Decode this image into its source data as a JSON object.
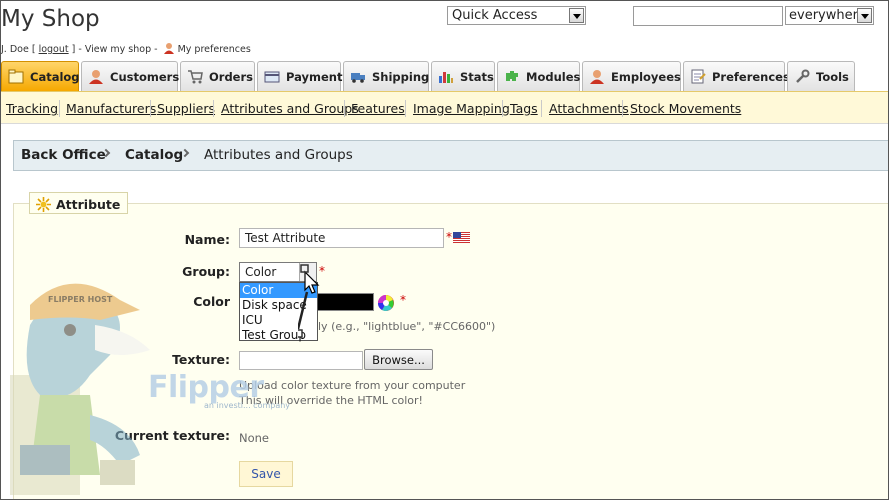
{
  "header": {
    "shop_title": "My Shop",
    "user_name": "J. Doe [",
    "logout": "logout",
    "user_tail": "] - View my shop -",
    "my_preferences": "My preferences",
    "quick_access": "Quick Access",
    "search_value": "",
    "search_scope": "everywhere"
  },
  "tabs": [
    {
      "label": "Catalog",
      "icon": "catalog-icon",
      "active": true
    },
    {
      "label": "Customers",
      "icon": "customers-icon"
    },
    {
      "label": "Orders",
      "icon": "orders-icon"
    },
    {
      "label": "Payment",
      "icon": "payment-icon"
    },
    {
      "label": "Shipping",
      "icon": "shipping-icon"
    },
    {
      "label": "Stats",
      "icon": "stats-icon"
    },
    {
      "label": "Modules",
      "icon": "modules-icon"
    },
    {
      "label": "Employees",
      "icon": "employees-icon"
    },
    {
      "label": "Preferences",
      "icon": "preferences-icon"
    },
    {
      "label": "Tools",
      "icon": "tools-icon"
    }
  ],
  "subnav": [
    "Tracking",
    "Manufacturers",
    "Suppliers",
    "Attributes and Groups",
    "Features",
    "Image Mapping",
    "Tags",
    "Attachments",
    "Stock Movements"
  ],
  "breadcrumb": [
    "Back Office",
    "Catalog",
    "Attributes and Groups"
  ],
  "form": {
    "legend": "Attribute",
    "name_label": "Name:",
    "name_value": "Test Attribute",
    "group_label": "Group:",
    "group_value": "Color",
    "group_options": [
      "Color",
      "Disk space",
      "ICU",
      "Test Group"
    ],
    "color_label": "Color",
    "color_hint": "ly (e.g., \"lightblue\", \"#CC6600\")",
    "texture_label": "Texture:",
    "browse_label": "Browse...",
    "texture_hint_1": "Upload color texture from your computer",
    "texture_hint_2": "This will override the HTML color!",
    "current_texture_label": "Current texture:",
    "current_texture_value": "None",
    "save_label": "Save",
    "required_mark": "*"
  },
  "watermark": {
    "brand": "Flipper",
    "tagline": "an investi... company",
    "cap_text": "FLIPPER HOST"
  },
  "colors": {
    "active_tab": "#f5a800",
    "subnav_bg": "#fff9d8",
    "breadcrumb_bg": "#e6eef2",
    "fieldset_bg": "#fffff0",
    "selected_option": "#3399ff",
    "required": "#cc0000"
  }
}
